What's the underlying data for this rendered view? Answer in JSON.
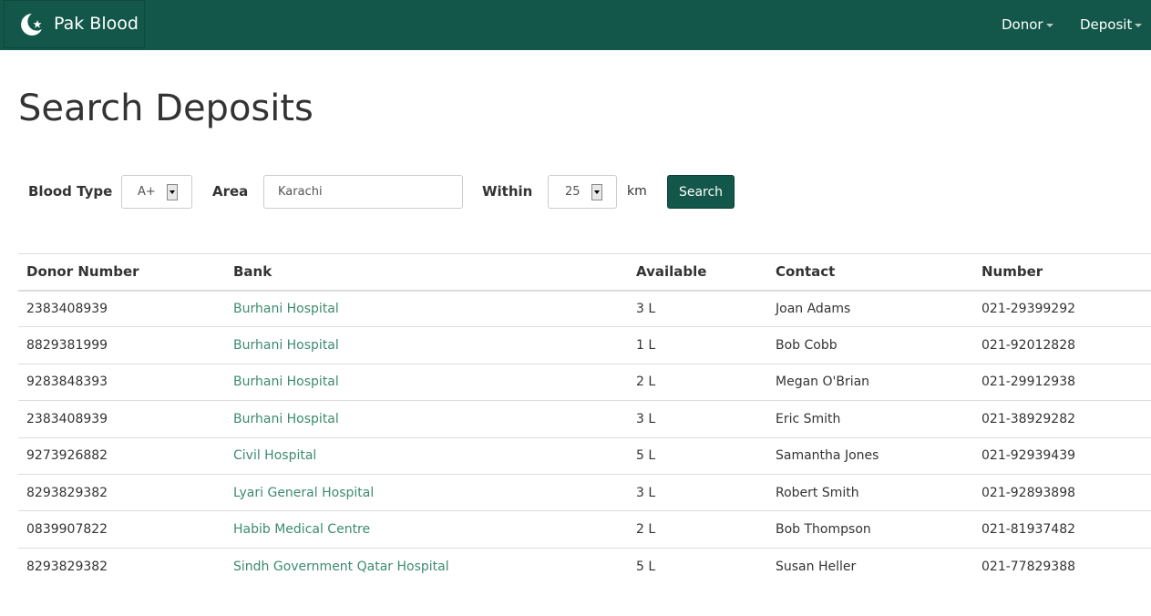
{
  "navbar": {
    "brand": "Pak Blood",
    "brand_icon": "crescent-star-icon",
    "menu": [
      {
        "label": "Donor"
      },
      {
        "label": "Deposit"
      }
    ]
  },
  "page": {
    "title": "Search Deposits"
  },
  "search_form": {
    "blood_type_label": "Blood Type",
    "blood_type_value": "A+",
    "area_label": "Area",
    "area_value": "Karachi",
    "within_label": "Within",
    "within_value": "25",
    "unit": "km",
    "button_label": "Search"
  },
  "table": {
    "columns": [
      "Donor Number",
      "Bank",
      "Available",
      "Contact",
      "Number"
    ],
    "rows": [
      {
        "donor_number": "2383408939",
        "bank": "Burhani Hospital",
        "available": "3 L",
        "contact": "Joan Adams",
        "number": "021-29399292"
      },
      {
        "donor_number": "8829381999",
        "bank": "Burhani Hospital",
        "available": "1 L",
        "contact": "Bob Cobb",
        "number": "021-92012828"
      },
      {
        "donor_number": "9283848393",
        "bank": "Burhani Hospital",
        "available": "2 L",
        "contact": "Megan O'Brian",
        "number": "021-29912938"
      },
      {
        "donor_number": "2383408939",
        "bank": "Burhani Hospital",
        "available": "3 L",
        "contact": "Eric Smith",
        "number": "021-38929282"
      },
      {
        "donor_number": "9273926882",
        "bank": "Civil Hospital",
        "available": "5 L",
        "contact": "Samantha Jones",
        "number": "021-92939439"
      },
      {
        "donor_number": "8293829382",
        "bank": "Lyari General Hospital",
        "available": "3 L",
        "contact": "Robert Smith",
        "number": "021-92893898"
      },
      {
        "donor_number": "0839907822",
        "bank": "Habib Medical Centre",
        "available": "2 L",
        "contact": "Bob Thompson",
        "number": "021-81937482"
      },
      {
        "donor_number": "8293829382",
        "bank": "Sindh Government Qatar Hospital",
        "available": "5 L",
        "contact": "Susan Heller",
        "number": "021-77829388"
      }
    ]
  },
  "colors": {
    "brand": "#12574a",
    "link": "#3d8b6e"
  }
}
